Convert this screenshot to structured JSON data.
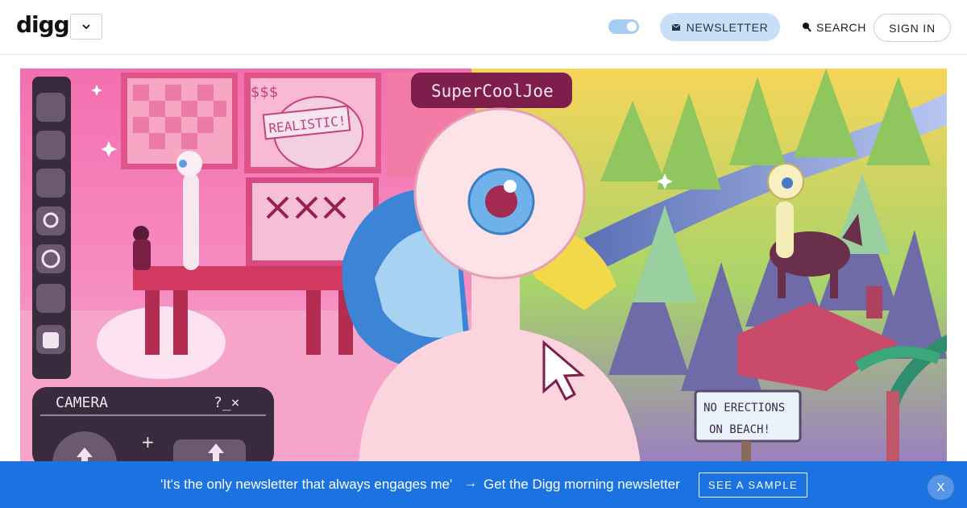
{
  "header": {
    "logo": "digg",
    "newsletter_label": "NEWSLETTER",
    "search_label": "SEARCH",
    "signin_label": "SIGN IN"
  },
  "hero": {
    "username_tag": "SuperCoolJoe",
    "sign_realistic": "REALISTIC!",
    "sign_money": "$$$",
    "camera_label": "CAMERA",
    "camera_controls": "?_×",
    "beach_sign_line1": "NO ERECTIONS",
    "beach_sign_line2": "ON BEACH!"
  },
  "banner": {
    "quote": "'It's the only newsletter that always engages me'",
    "arrow": "→",
    "cta": "Get the Digg morning newsletter",
    "sample_label": "SEE A SAMPLE",
    "close_label": "X"
  },
  "colors": {
    "banner_bg": "#1a73e0",
    "newsletter_bg": "#c9dff8",
    "toggle_bg": "#a8cdf5"
  }
}
